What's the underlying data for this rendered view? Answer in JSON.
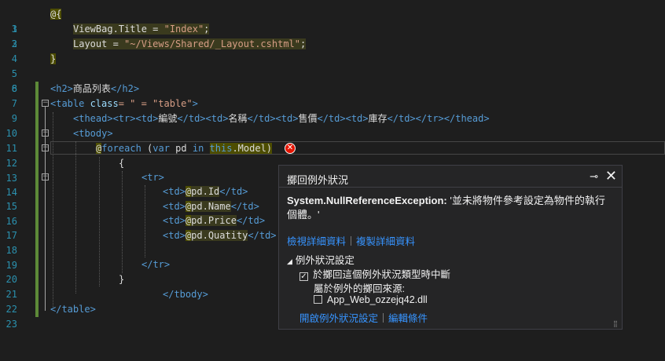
{
  "editor": {
    "lines": [
      {
        "n": "1"
      },
      {
        "n": "2"
      },
      {
        "n": "3"
      },
      {
        "n": "4"
      },
      {
        "n": "5"
      },
      {
        "n": "6"
      },
      {
        "n": "7"
      },
      {
        "n": "8"
      },
      {
        "n": "9"
      },
      {
        "n": "10"
      },
      {
        "n": "11"
      },
      {
        "n": "12"
      },
      {
        "n": "13"
      },
      {
        "n": "14"
      },
      {
        "n": "15"
      },
      {
        "n": "16"
      },
      {
        "n": "17"
      },
      {
        "n": "18"
      },
      {
        "n": "19"
      },
      {
        "n": "20"
      },
      {
        "n": "21"
      },
      {
        "n": "22"
      },
      {
        "n": "23"
      }
    ],
    "code": {
      "l1": "@{",
      "l3a": "ViewBag.Title = ",
      "l3b": "\"Index\"",
      "l3c": ";",
      "l4a": "Layout = ",
      "l4b": "\"~/Views/Shared/_Layout.cshtml\"",
      "l4c": ";",
      "l5": "}",
      "l8a": "<h2>",
      "l8b": "商品列表",
      "l8c": "</h2>",
      "l9a": "<table ",
      "l9b": "class",
      "l9c": "= \" = \"table\"",
      "l9d": ">",
      "l10a": "<thead><tr><td>",
      "l10b": "編號",
      "l10c": "</td><td>",
      "l10d": "名稱",
      "l10e": "</td><td>",
      "l10f": "售價",
      "l10g": "</td><td>",
      "l10h": "庫存",
      "l10i": "</td></tr></thead>",
      "l11": "<tbody>",
      "l12a": "@",
      "l12b": "foreach",
      "l12c": " (",
      "l12d": "var",
      "l12e": " pd ",
      "l12f": "in",
      "l12g": " ",
      "l12h": "this",
      "l12i": ".Model)",
      "l13": "{",
      "l14": "<tr>",
      "l15a": "<td>",
      "l15b": "@",
      "l15c": "pd.Id",
      "l15d": "</td>",
      "l16a": "<td>",
      "l16b": "@",
      "l16c": "pd.Name",
      "l16d": "</td>",
      "l17a": "<td>",
      "l17b": "@",
      "l17c": "pd.Price",
      "l17d": "</td>",
      "l18a": "<td>",
      "l18b": "@",
      "l18c": "pd.Quatity",
      "l18d": "</td>",
      "l20": "</tr>",
      "l21": "}",
      "l22": "</tbody>",
      "l23": "</table>"
    }
  },
  "popup": {
    "title": "擲回例外狀況",
    "pin": "⊸",
    "close": "✕",
    "message_bold": "System.NullReferenceException:",
    "message_rest": " '並未將物件參考設定為物件的執行個體。'",
    "view_details": "檢視詳細資料",
    "copy_details": "複製詳細資料",
    "section_label": "例外狀況設定",
    "break_label": "於擲回這個例外狀況類型時中斷",
    "break_checked": true,
    "except_label": "屬於例外的擲回來源:",
    "module_label": "App_Web_ozzejq42.dll",
    "module_checked": false,
    "open_settings": "開啟例外狀況設定",
    "edit_conditions": "編輯條件"
  }
}
